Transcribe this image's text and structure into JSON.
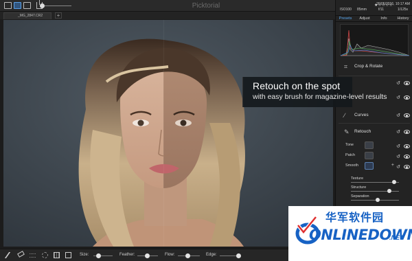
{
  "app": {
    "title": "Picktorial"
  },
  "toolbar": {
    "view_icons": [
      "single-view-icon",
      "split-view-icon",
      "compare-view-icon"
    ],
    "share_icon": "share-icon"
  },
  "tabs": {
    "file_name": "_MG_2847.CR2",
    "add_label": "+"
  },
  "callout": {
    "title": "Retouch on the spot",
    "subtitle": "with easy brush for magazine-level results"
  },
  "bottom_toolbar": {
    "size_label": "Size:",
    "feather_label": "Feather:",
    "flow_label": "Flow:",
    "edge_label": "Edge:"
  },
  "panel": {
    "info": {
      "date": "26/05/2016, 10:17 AM",
      "iso": "ISO100",
      "focal": "85mm",
      "aperture": "f/11",
      "shutter": "1/125s",
      "stars": "★☆☆☆☆"
    },
    "tabs": [
      "Presets",
      "Adjust",
      "Info",
      "History"
    ],
    "active_tab": "Presets",
    "features": {
      "crop": "Crop & Rotate",
      "curves": "Curves",
      "retouch": "Retouch"
    },
    "retouch_tools": {
      "tone": "Tone",
      "patch": "Patch",
      "smooth": "Smooth"
    },
    "sliders": {
      "texture": {
        "label": "Texture",
        "value": 0.9
      },
      "structure": {
        "label": "Structure",
        "value": 0.8
      },
      "separation": {
        "label": "Separation",
        "value": 0.55
      }
    }
  },
  "watermark": {
    "cn": "华军软件园",
    "en": "ONLINEDOWN",
    "net": ".NET"
  },
  "colors": {
    "accent": "#5aa8f0",
    "watermark": "#1762c4"
  }
}
